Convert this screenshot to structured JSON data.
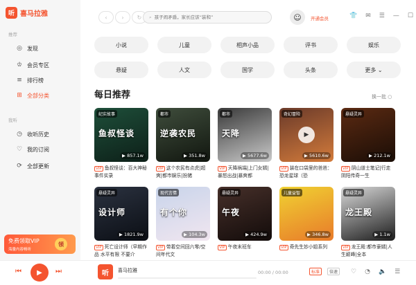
{
  "app": {
    "name": "喜马拉雅",
    "logo_glyph": "听"
  },
  "sidebar": {
    "section_recommend": "推荐",
    "items": [
      {
        "label": "发现",
        "icon": "compass-icon",
        "glyph": "◎"
      },
      {
        "label": "会员专区",
        "icon": "crown-icon",
        "glyph": "♔"
      },
      {
        "label": "排行榜",
        "icon": "ranking-icon",
        "glyph": "≡"
      },
      {
        "label": "全部分类",
        "icon": "grid-icon",
        "glyph": "⊞"
      }
    ],
    "section_mine": "我听",
    "mine_items": [
      {
        "label": "收听历史",
        "icon": "clock-icon",
        "glyph": "◷"
      },
      {
        "label": "我的订阅",
        "icon": "heart-icon",
        "glyph": "♡"
      },
      {
        "label": "全部更新",
        "icon": "refresh-icon",
        "glyph": "⟳"
      }
    ],
    "vip_banner": {
      "title": "免费领取VIP",
      "subtitle": "海量内容畅听",
      "badge": "领"
    }
  },
  "header": {
    "back": "‹",
    "forward": "›",
    "reload": "↻",
    "search_placeholder": "孩子闹矛盾，家长应该“装和”",
    "vip_link": "开通会员"
  },
  "categories": [
    "小说",
    "儿童",
    "相声小品",
    "评书",
    "娱乐",
    "悬疑",
    "人文",
    "国学",
    "头条",
    "更多 ⌄"
  ],
  "section": {
    "title": "每日推荐",
    "refresh": "换一批 ○"
  },
  "cards": [
    {
      "tag": "纪实故事",
      "cover_text": "鱼叔怪谈",
      "plays": "857.1w",
      "title": "鱼叔怪谈：百大神秘事件实录",
      "color1": "#1e4f3a",
      "color2": "#0d1f18"
    },
    {
      "tag": "都市",
      "cover_text": "逆袭农民",
      "plays": "351.8w",
      "title": "这个农民有点虎|超爽|都市娱乐|扮猪",
      "color1": "#3f4d3c",
      "color2": "#11160f"
    },
    {
      "tag": "都市",
      "cover_text": "天降",
      "plays": "5677.6w",
      "title": "天降祸端|上门女婿|暴怒出战|暴爽都",
      "color1": "#3a3a3a",
      "color2": "#c9c9c9"
    },
    {
      "tag": "奇幻冒险",
      "cover_text": "",
      "plays": "5610.6w",
      "title": "装在口袋里的爸爸：恐龙星球（恐",
      "color1": "#6a3a2a",
      "color2": "#d37b3b"
    },
    {
      "tag": "悬疑灵异",
      "cover_text": "",
      "plays": "212.1w",
      "title": "阴山道士笔记|行走阴阳传奇一生",
      "color1": "#5b2a12",
      "color2": "#1a0d06"
    },
    {
      "tag": "悬疑灵异",
      "cover_text": "设计师",
      "plays": "1821.9w",
      "title": "死亡设计师（早期作品 水平有限 不要介",
      "color1": "#2b3240",
      "color2": "#0b0e14"
    },
    {
      "tag": "现代言情",
      "cover_text": "有个你",
      "plays": "104.3w",
      "title": "带着空间回六零/空间年代文",
      "color1": "#c8d4ea",
      "color2": "#f1e6f0"
    },
    {
      "tag": "悬疑灵异",
      "cover_text": "午夜",
      "plays": "424.9w",
      "title": "午夜末班车",
      "color1": "#47302a",
      "color2": "#120b0a"
    },
    {
      "tag": "儿童益智",
      "cover_text": "",
      "plays": "346.8w",
      "title": "奇先生妙小姐系列",
      "color1": "#f0d232",
      "color2": "#e87a2a"
    },
    {
      "tag": "悬疑灵异",
      "cover_text": "龙王殿",
      "plays": "1.1w",
      "title": "龙王殿:都市豪婿|人生巅峰|全本",
      "color1": "#d8d8d8",
      "color2": "#1d1d1d"
    }
  ],
  "card_vip": "VIP",
  "player": {
    "cover_glyph": "听",
    "title": "喜马拉雅",
    "time": "00:00 / 00:00",
    "quality": "标准",
    "speed": "倍速",
    "progress": 0
  },
  "colors": {
    "accent": "#f4542f"
  }
}
